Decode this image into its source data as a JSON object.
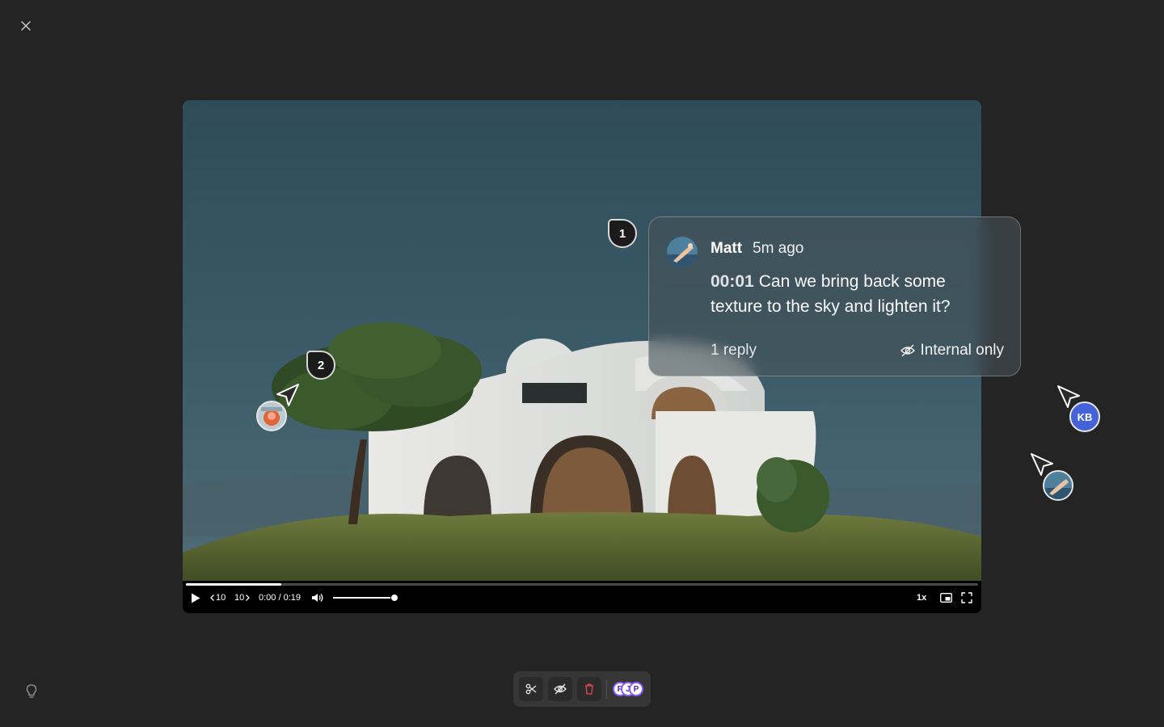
{
  "player": {
    "current_time": "0:00",
    "duration": "0:19",
    "time_display": "0:00 / 0:19",
    "progress": 0.12,
    "volume": 0.98,
    "rewind_label": "10",
    "forward_label": "10",
    "speed_label": "1x"
  },
  "markers": [
    {
      "label": "1"
    },
    {
      "label": "2"
    }
  ],
  "comment": {
    "author": "Matt",
    "time_ago": "5m ago",
    "timecode": "00:01",
    "text": "Can we bring back some texture to the sky and lighten it?",
    "reply_label": "1 reply",
    "visibility_label": "Internal only"
  },
  "collaborators": {
    "kb_initials": "KB",
    "kb_color": "#4563d8"
  },
  "toolbar": {
    "avatar_labels": [
      "P",
      "J",
      "P"
    ]
  },
  "colors": {
    "background": "#242424",
    "accent_purple": "#8b5cf6",
    "delete_red": "#e5484d"
  }
}
